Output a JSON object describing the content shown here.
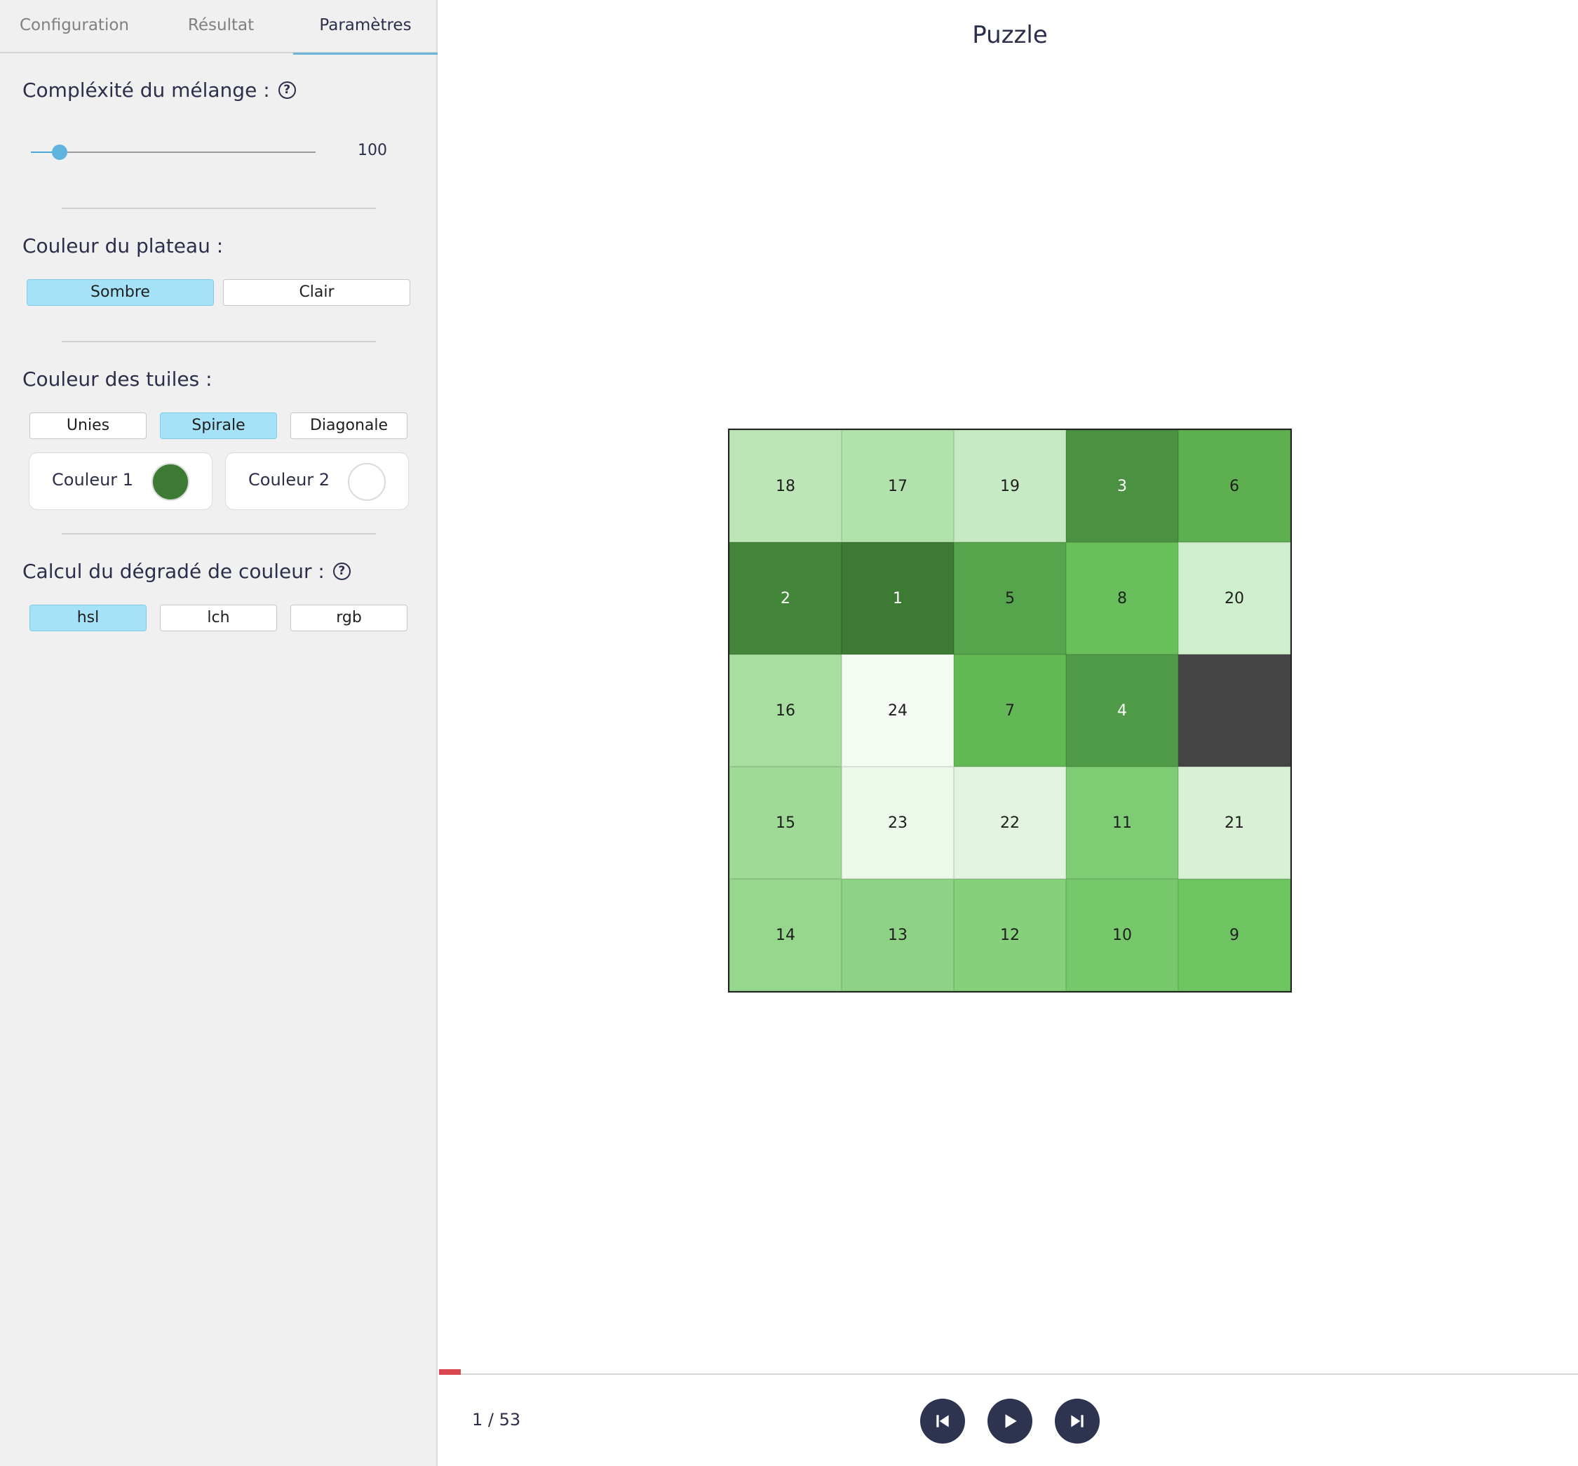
{
  "tabs": [
    {
      "label": "Configuration",
      "active": false
    },
    {
      "label": "Résultat",
      "active": false
    },
    {
      "label": "Paramètres",
      "active": true
    }
  ],
  "settings": {
    "complexity": {
      "label": "Compléxité du mélange :",
      "value": "100",
      "fraction": 0.1,
      "help_icon": "help-circle-icon"
    },
    "board_color": {
      "label": "Couleur du plateau :",
      "options": [
        "Sombre",
        "Clair"
      ],
      "selected": "Sombre"
    },
    "tile_color": {
      "label": "Couleur des tuiles :",
      "options": [
        "Unies",
        "Spirale",
        "Diagonale"
      ],
      "selected": "Spirale",
      "color1": {
        "label": "Couleur 1",
        "value": "#3d7a34"
      },
      "color2": {
        "label": "Couleur 2",
        "value": "#ffffff"
      }
    },
    "gradient": {
      "label": "Calcul du dégradé de couleur :",
      "options": [
        "hsl",
        "lch",
        "rgb"
      ],
      "selected": "hsl",
      "help_icon": "help-circle-icon"
    }
  },
  "main": {
    "title": "Puzzle",
    "board_bg": "#444444",
    "tiles": [
      [
        "18",
        "17",
        "19",
        "3",
        "6"
      ],
      [
        "2",
        "1",
        "5",
        "8",
        "20"
      ],
      [
        "16",
        "24",
        "7",
        "4",
        ""
      ],
      [
        "15",
        "23",
        "22",
        "11",
        "21"
      ],
      [
        "14",
        "13",
        "12",
        "10",
        "9"
      ]
    ],
    "tile_colors": {
      "1": "#3d7a34",
      "2": "#43863a",
      "3": "#4a9142",
      "4": "#509b47",
      "5": "#56a44c",
      "6": "#5daf50",
      "7": "#63b856",
      "8": "#69c05b",
      "9": "#6fc462",
      "10": "#76c86b",
      "11": "#7ecc73",
      "12": "#86d07c",
      "13": "#8ed385",
      "14": "#96d68d",
      "15": "#9fda96",
      "16": "#a8de9f",
      "17": "#b2e2ab",
      "18": "#bce6b5",
      "19": "#c6eac1",
      "20": "#cfeecb",
      "21": "#d8f1d5",
      "22": "#e2f4df",
      "23": "#ebf8ea",
      "24": "#f4fbf3"
    }
  },
  "player": {
    "counter": "1 / 53",
    "progress": 0.0189,
    "buttons": [
      "skip-back-icon",
      "play-icon",
      "skip-forward-icon"
    ]
  }
}
